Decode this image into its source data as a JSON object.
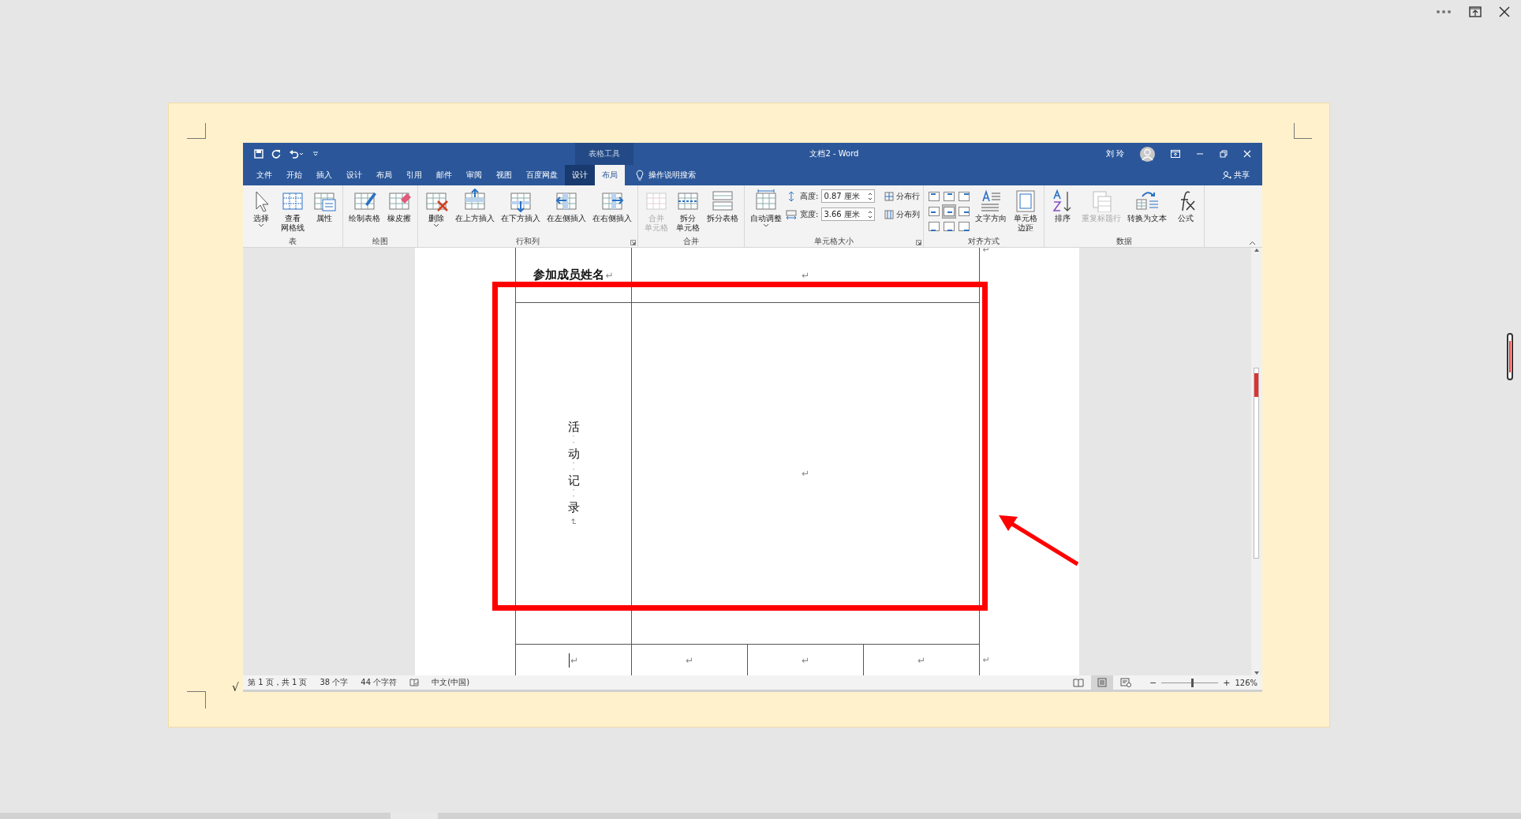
{
  "title_bar": {
    "title": "文档2 - Word",
    "context_label": "表格工具",
    "user": "刘 玲"
  },
  "tabs": [
    {
      "label": "文件",
      "selected": false,
      "contextual": false
    },
    {
      "label": "开始",
      "selected": false,
      "contextual": false
    },
    {
      "label": "插入",
      "selected": false,
      "contextual": false
    },
    {
      "label": "设计",
      "selected": false,
      "contextual": false
    },
    {
      "label": "布局",
      "selected": false,
      "contextual": false
    },
    {
      "label": "引用",
      "selected": false,
      "contextual": false
    },
    {
      "label": "邮件",
      "selected": false,
      "contextual": false
    },
    {
      "label": "审阅",
      "selected": false,
      "contextual": false
    },
    {
      "label": "视图",
      "selected": false,
      "contextual": false
    },
    {
      "label": "百度网盘",
      "selected": false,
      "contextual": false
    },
    {
      "label": "设计",
      "selected": false,
      "contextual": true
    },
    {
      "label": "布局",
      "selected": true,
      "contextual": true
    }
  ],
  "tell_me": {
    "placeholder": "操作说明搜索"
  },
  "share": "共享",
  "ribbon_groups": [
    {
      "label": "表",
      "launcher": false,
      "items": [
        {
          "kind": "select",
          "label": "选择",
          "menu": true,
          "disabled": false
        },
        {
          "kind": "gridlines",
          "label": [
            "查看",
            "网格线"
          ],
          "menu": false,
          "disabled": false
        },
        {
          "kind": "properties",
          "label": "属性",
          "menu": false,
          "disabled": false
        }
      ]
    },
    {
      "label": "绘图",
      "launcher": false,
      "items": [
        {
          "kind": "draw",
          "label": "绘制表格",
          "menu": false,
          "disabled": false
        },
        {
          "kind": "eraser",
          "label": "橡皮擦",
          "menu": false,
          "disabled": false
        }
      ]
    },
    {
      "label": "行和列",
      "launcher": true,
      "items": [
        {
          "kind": "delete",
          "label": "删除",
          "menu": true,
          "disabled": false
        },
        {
          "kind": "ins_above",
          "label": "在上方插入",
          "menu": false,
          "disabled": false
        },
        {
          "kind": "ins_below",
          "label": "在下方插入",
          "menu": false,
          "disabled": false
        },
        {
          "kind": "ins_left",
          "label": "在左侧插入",
          "menu": false,
          "disabled": false
        },
        {
          "kind": "ins_right",
          "label": "在右侧插入",
          "menu": false,
          "disabled": false
        }
      ]
    },
    {
      "label": "合并",
      "launcher": false,
      "items": [
        {
          "kind": "merge",
          "label": [
            "合并",
            "单元格"
          ],
          "menu": false,
          "disabled": true
        },
        {
          "kind": "split_cells",
          "label": [
            "拆分",
            "单元格"
          ],
          "menu": false,
          "disabled": false
        },
        {
          "kind": "split_table",
          "label": "拆分表格",
          "menu": false,
          "disabled": false
        }
      ]
    },
    {
      "label": "单元格大小",
      "launcher": true,
      "items": [
        {
          "kind": "autofit",
          "label": "自动调整",
          "menu": true,
          "disabled": false
        },
        {
          "kind": "size_fields",
          "fields": [
            {
              "label": "高度:",
              "value": "0.87 厘米"
            },
            {
              "label": "宽度:",
              "value": "3.66 厘米"
            }
          ],
          "distribute": [
            "分布行",
            "分布列"
          ]
        }
      ]
    },
    {
      "label": "对齐方式",
      "launcher": false,
      "items": [
        {
          "kind": "align_grid",
          "cells": [
            {
              "selected": false
            },
            {
              "selected": false
            },
            {
              "selected": false
            },
            {
              "selected": false
            },
            {
              "selected": true
            },
            {
              "selected": false
            },
            {
              "selected": false
            },
            {
              "selected": false
            },
            {
              "selected": false
            }
          ]
        },
        {
          "kind": "text_dir",
          "label": "文字方向",
          "menu": false,
          "disabled": false
        },
        {
          "kind": "margins",
          "label": [
            "单元格",
            "边距"
          ],
          "menu": false,
          "disabled": false
        }
      ]
    },
    {
      "label": "数据",
      "launcher": false,
      "items": [
        {
          "kind": "sort",
          "label": "排序",
          "menu": false,
          "disabled": false
        },
        {
          "kind": "repeat_header",
          "label": "重复标题行",
          "menu": false,
          "disabled": true
        },
        {
          "kind": "convert",
          "label": "转换为文本",
          "menu": false,
          "disabled": false
        },
        {
          "kind": "formula",
          "label": "公式",
          "menu": false,
          "disabled": false
        }
      ]
    }
  ],
  "document": {
    "name_row": {
      "label": "参加成员姓名",
      "label_mark": "↵",
      "value_mark": "↵",
      "row_end": "↵"
    },
    "record_row": {
      "label": "活··动··记··录",
      "label_mark": "↵",
      "value_mark": "↵"
    },
    "bottom_row": {
      "cells": [
        "↵",
        "↵",
        "↵",
        "↵"
      ],
      "row_end": "↵"
    }
  },
  "status_bar": {
    "items": [
      {
        "kind": "text",
        "text": "第 1 页，共 1 页"
      },
      {
        "kind": "text",
        "text": "38 个字"
      },
      {
        "kind": "text",
        "text": "44 个字符"
      },
      {
        "kind": "proofing"
      },
      {
        "kind": "text",
        "text": "中文(中国)"
      }
    ],
    "views": [
      {
        "kind": "read",
        "selected": false
      },
      {
        "kind": "print",
        "selected": true
      },
      {
        "kind": "web",
        "selected": false
      }
    ],
    "zoom": {
      "minus": "−",
      "plus": "+",
      "level": 0.54,
      "reading": "126%"
    }
  },
  "margin_note": "√"
}
